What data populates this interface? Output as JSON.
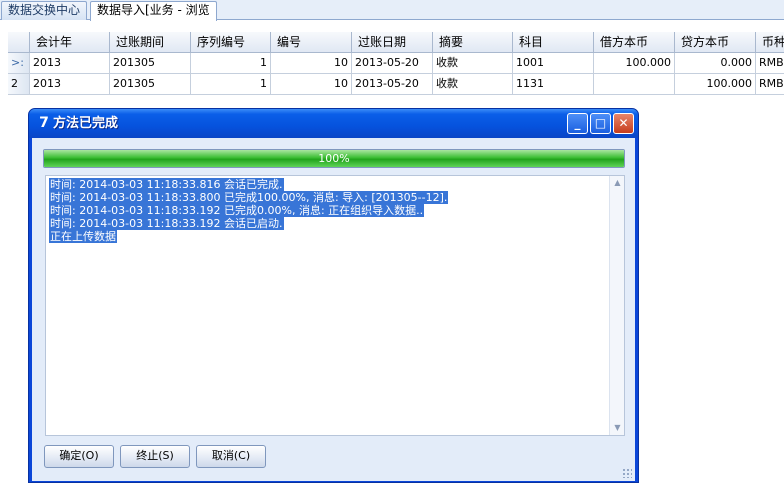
{
  "tabs": [
    {
      "label": "数据交换中心",
      "active": false
    },
    {
      "label": "数据导入[业务 - 浏览",
      "active": true
    }
  ],
  "grid": {
    "columns": [
      "会计年",
      "过账期间",
      "序列编号",
      "编号",
      "过账日期",
      "摘要",
      "科目",
      "借方本币",
      "贷方本币",
      "币种"
    ],
    "row_headers": [
      ">:",
      "2"
    ],
    "rows": [
      {
        "year": "2013",
        "period": "201305",
        "seq": "1",
        "no": "10",
        "date": "2013-05-20",
        "abstract": "收款",
        "account": "1001",
        "debit": "100.000",
        "credit": "0.000",
        "currency": "RMB"
      },
      {
        "year": "2013",
        "period": "201305",
        "seq": "1",
        "no": "10",
        "date": "2013-05-20",
        "abstract": "收款",
        "account": "1131",
        "debit": "",
        "credit": "100.000",
        "currency": "RMB"
      }
    ]
  },
  "dialog": {
    "title": "方法已完成",
    "progress": {
      "percent": 100,
      "label": "100%"
    },
    "log": [
      "时间: 2014-03-03 11:18:33.816  会话已完成.",
      "时间: 2014-03-03 11:18:33.800  已完成100.00%, 消息: 导入: [201305--12].",
      "时间: 2014-03-03 11:18:33.192  已完成0.00%, 消息: 正在组织导入数据..",
      "时间: 2014-03-03 11:18:33.192  会话已启动.",
      "正在上传数据"
    ],
    "buttons": {
      "ok": "确定(O)",
      "stop": "终止(S)",
      "cancel": "取消(C)"
    }
  },
  "colors": {
    "titlebar": "#0a5ee8",
    "progress": "#3cbe34",
    "selection": "#3875d7"
  }
}
